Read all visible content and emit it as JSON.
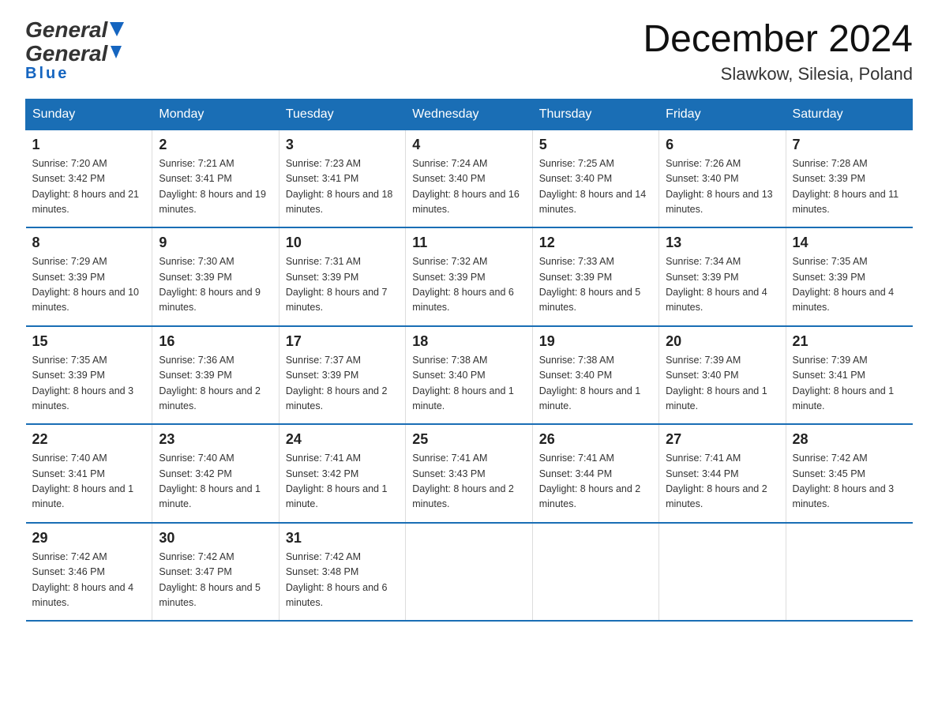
{
  "header": {
    "logo_general": "General",
    "logo_blue": "Blue",
    "month_title": "December 2024",
    "location": "Slawkow, Silesia, Poland"
  },
  "columns": [
    "Sunday",
    "Monday",
    "Tuesday",
    "Wednesday",
    "Thursday",
    "Friday",
    "Saturday"
  ],
  "weeks": [
    [
      {
        "day": "1",
        "sunrise": "Sunrise: 7:20 AM",
        "sunset": "Sunset: 3:42 PM",
        "daylight": "Daylight: 8 hours and 21 minutes."
      },
      {
        "day": "2",
        "sunrise": "Sunrise: 7:21 AM",
        "sunset": "Sunset: 3:41 PM",
        "daylight": "Daylight: 8 hours and 19 minutes."
      },
      {
        "day": "3",
        "sunrise": "Sunrise: 7:23 AM",
        "sunset": "Sunset: 3:41 PM",
        "daylight": "Daylight: 8 hours and 18 minutes."
      },
      {
        "day": "4",
        "sunrise": "Sunrise: 7:24 AM",
        "sunset": "Sunset: 3:40 PM",
        "daylight": "Daylight: 8 hours and 16 minutes."
      },
      {
        "day": "5",
        "sunrise": "Sunrise: 7:25 AM",
        "sunset": "Sunset: 3:40 PM",
        "daylight": "Daylight: 8 hours and 14 minutes."
      },
      {
        "day": "6",
        "sunrise": "Sunrise: 7:26 AM",
        "sunset": "Sunset: 3:40 PM",
        "daylight": "Daylight: 8 hours and 13 minutes."
      },
      {
        "day": "7",
        "sunrise": "Sunrise: 7:28 AM",
        "sunset": "Sunset: 3:39 PM",
        "daylight": "Daylight: 8 hours and 11 minutes."
      }
    ],
    [
      {
        "day": "8",
        "sunrise": "Sunrise: 7:29 AM",
        "sunset": "Sunset: 3:39 PM",
        "daylight": "Daylight: 8 hours and 10 minutes."
      },
      {
        "day": "9",
        "sunrise": "Sunrise: 7:30 AM",
        "sunset": "Sunset: 3:39 PM",
        "daylight": "Daylight: 8 hours and 9 minutes."
      },
      {
        "day": "10",
        "sunrise": "Sunrise: 7:31 AM",
        "sunset": "Sunset: 3:39 PM",
        "daylight": "Daylight: 8 hours and 7 minutes."
      },
      {
        "day": "11",
        "sunrise": "Sunrise: 7:32 AM",
        "sunset": "Sunset: 3:39 PM",
        "daylight": "Daylight: 8 hours and 6 minutes."
      },
      {
        "day": "12",
        "sunrise": "Sunrise: 7:33 AM",
        "sunset": "Sunset: 3:39 PM",
        "daylight": "Daylight: 8 hours and 5 minutes."
      },
      {
        "day": "13",
        "sunrise": "Sunrise: 7:34 AM",
        "sunset": "Sunset: 3:39 PM",
        "daylight": "Daylight: 8 hours and 4 minutes."
      },
      {
        "day": "14",
        "sunrise": "Sunrise: 7:35 AM",
        "sunset": "Sunset: 3:39 PM",
        "daylight": "Daylight: 8 hours and 4 minutes."
      }
    ],
    [
      {
        "day": "15",
        "sunrise": "Sunrise: 7:35 AM",
        "sunset": "Sunset: 3:39 PM",
        "daylight": "Daylight: 8 hours and 3 minutes."
      },
      {
        "day": "16",
        "sunrise": "Sunrise: 7:36 AM",
        "sunset": "Sunset: 3:39 PM",
        "daylight": "Daylight: 8 hours and 2 minutes."
      },
      {
        "day": "17",
        "sunrise": "Sunrise: 7:37 AM",
        "sunset": "Sunset: 3:39 PM",
        "daylight": "Daylight: 8 hours and 2 minutes."
      },
      {
        "day": "18",
        "sunrise": "Sunrise: 7:38 AM",
        "sunset": "Sunset: 3:40 PM",
        "daylight": "Daylight: 8 hours and 1 minute."
      },
      {
        "day": "19",
        "sunrise": "Sunrise: 7:38 AM",
        "sunset": "Sunset: 3:40 PM",
        "daylight": "Daylight: 8 hours and 1 minute."
      },
      {
        "day": "20",
        "sunrise": "Sunrise: 7:39 AM",
        "sunset": "Sunset: 3:40 PM",
        "daylight": "Daylight: 8 hours and 1 minute."
      },
      {
        "day": "21",
        "sunrise": "Sunrise: 7:39 AM",
        "sunset": "Sunset: 3:41 PM",
        "daylight": "Daylight: 8 hours and 1 minute."
      }
    ],
    [
      {
        "day": "22",
        "sunrise": "Sunrise: 7:40 AM",
        "sunset": "Sunset: 3:41 PM",
        "daylight": "Daylight: 8 hours and 1 minute."
      },
      {
        "day": "23",
        "sunrise": "Sunrise: 7:40 AM",
        "sunset": "Sunset: 3:42 PM",
        "daylight": "Daylight: 8 hours and 1 minute."
      },
      {
        "day": "24",
        "sunrise": "Sunrise: 7:41 AM",
        "sunset": "Sunset: 3:42 PM",
        "daylight": "Daylight: 8 hours and 1 minute."
      },
      {
        "day": "25",
        "sunrise": "Sunrise: 7:41 AM",
        "sunset": "Sunset: 3:43 PM",
        "daylight": "Daylight: 8 hours and 2 minutes."
      },
      {
        "day": "26",
        "sunrise": "Sunrise: 7:41 AM",
        "sunset": "Sunset: 3:44 PM",
        "daylight": "Daylight: 8 hours and 2 minutes."
      },
      {
        "day": "27",
        "sunrise": "Sunrise: 7:41 AM",
        "sunset": "Sunset: 3:44 PM",
        "daylight": "Daylight: 8 hours and 2 minutes."
      },
      {
        "day": "28",
        "sunrise": "Sunrise: 7:42 AM",
        "sunset": "Sunset: 3:45 PM",
        "daylight": "Daylight: 8 hours and 3 minutes."
      }
    ],
    [
      {
        "day": "29",
        "sunrise": "Sunrise: 7:42 AM",
        "sunset": "Sunset: 3:46 PM",
        "daylight": "Daylight: 8 hours and 4 minutes."
      },
      {
        "day": "30",
        "sunrise": "Sunrise: 7:42 AM",
        "sunset": "Sunset: 3:47 PM",
        "daylight": "Daylight: 8 hours and 5 minutes."
      },
      {
        "day": "31",
        "sunrise": "Sunrise: 7:42 AM",
        "sunset": "Sunset: 3:48 PM",
        "daylight": "Daylight: 8 hours and 6 minutes."
      },
      null,
      null,
      null,
      null
    ]
  ]
}
